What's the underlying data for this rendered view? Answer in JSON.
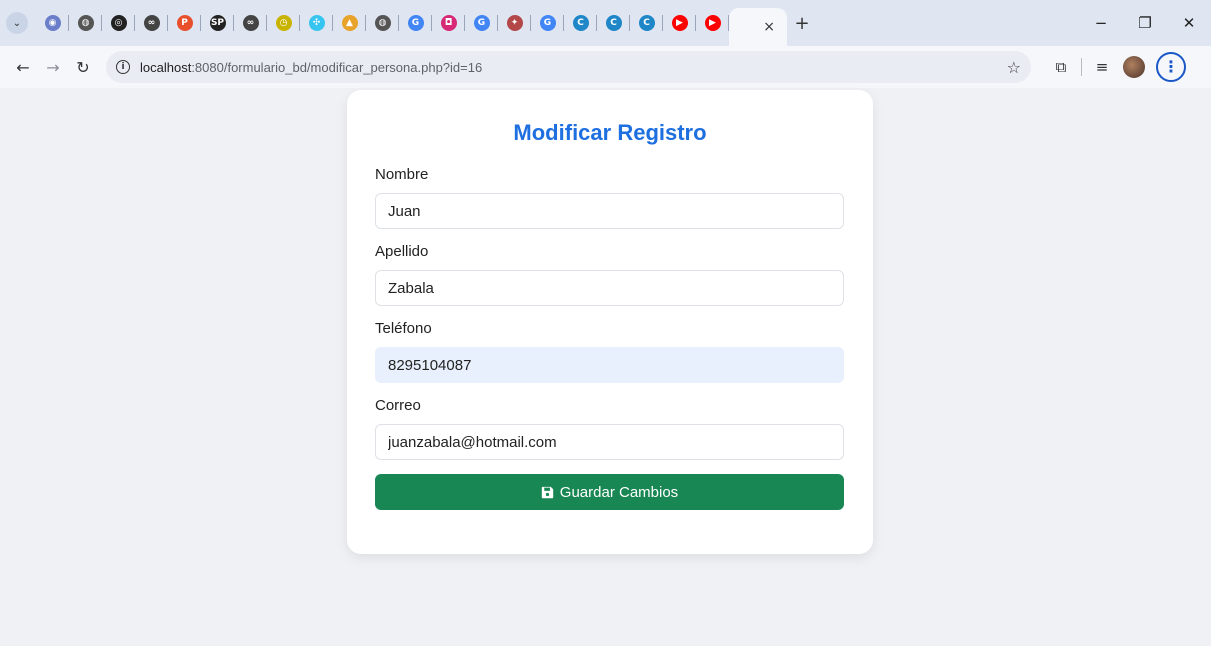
{
  "browser": {
    "tabs": [
      {
        "name": "tab-1",
        "icon": "extension-icon",
        "color": "#6b7ec9",
        "glyph": "◉"
      },
      {
        "name": "tab-2",
        "icon": "globe-icon",
        "color": "#555555",
        "glyph": "◍"
      },
      {
        "name": "tab-3",
        "icon": "openai-icon",
        "color": "#222222",
        "glyph": "◎"
      },
      {
        "name": "tab-4",
        "icon": "infinity-icon",
        "color": "#444444",
        "glyph": "∞"
      },
      {
        "name": "tab-5",
        "icon": "p-logo-icon",
        "color": "#e8502b",
        "glyph": "P"
      },
      {
        "name": "tab-6",
        "icon": "sp-icon",
        "color": "#222222",
        "glyph": "SP"
      },
      {
        "name": "tab-7",
        "icon": "infinity-icon",
        "color": "#444444",
        "glyph": "∞"
      },
      {
        "name": "tab-8",
        "icon": "clock-icon",
        "color": "#c8b400",
        "glyph": "◷"
      },
      {
        "name": "tab-9",
        "icon": "slack-icon",
        "color": "#36c5f0",
        "glyph": "✣"
      },
      {
        "name": "tab-10",
        "icon": "chart-icon",
        "color": "#e8a32b",
        "glyph": "▲"
      },
      {
        "name": "tab-11",
        "icon": "globe-icon",
        "color": "#555555",
        "glyph": "◍"
      },
      {
        "name": "tab-12",
        "icon": "google-icon",
        "color": "#4285f4",
        "glyph": "G"
      },
      {
        "name": "tab-13",
        "icon": "instagram-icon",
        "color": "#d62976",
        "glyph": "◘"
      },
      {
        "name": "tab-14",
        "icon": "google-icon",
        "color": "#4285f4",
        "glyph": "G"
      },
      {
        "name": "tab-15",
        "icon": "tool-icon",
        "color": "#b34848",
        "glyph": "✦"
      },
      {
        "name": "tab-16",
        "icon": "google-icon",
        "color": "#4285f4",
        "glyph": "G"
      },
      {
        "name": "tab-17",
        "icon": "c-logo-icon",
        "color": "#1f87c8",
        "glyph": "C"
      },
      {
        "name": "tab-18",
        "icon": "c-logo-icon",
        "color": "#1f87c8",
        "glyph": "C"
      },
      {
        "name": "tab-19",
        "icon": "c-logo-icon",
        "color": "#1f87c8",
        "glyph": "C"
      },
      {
        "name": "tab-20",
        "icon": "youtube-icon",
        "color": "#ff0000",
        "glyph": "▶"
      },
      {
        "name": "tab-21",
        "icon": "youtube-icon",
        "color": "#ff0000",
        "glyph": "▶"
      }
    ],
    "active_tab_close": "×",
    "new_tab": "+",
    "window": {
      "minimize": "−",
      "restore": "❐",
      "close": "✕"
    },
    "nav": {
      "back": "←",
      "forward": "→",
      "reload": "↻"
    },
    "url": {
      "host": "localhost",
      "path": ":8080/formulario_bd/modificar_persona.php?id=16"
    },
    "star": "☆",
    "extensions": "⧉",
    "media": "≡",
    "menu": "⋮"
  },
  "form": {
    "title": "Modificar Registro",
    "fields": [
      {
        "label": "Nombre",
        "value": "Juan"
      },
      {
        "label": "Apellido",
        "value": "Zabala"
      },
      {
        "label": "Teléfono",
        "value": "8295104087"
      },
      {
        "label": "Correo",
        "value": "juanzabala@hotmail.com"
      }
    ],
    "submit_label": "Guardar Cambios"
  },
  "colors": {
    "accent": "#1e6fe0",
    "submit": "#198754",
    "autofill": "#e8f0fe"
  }
}
